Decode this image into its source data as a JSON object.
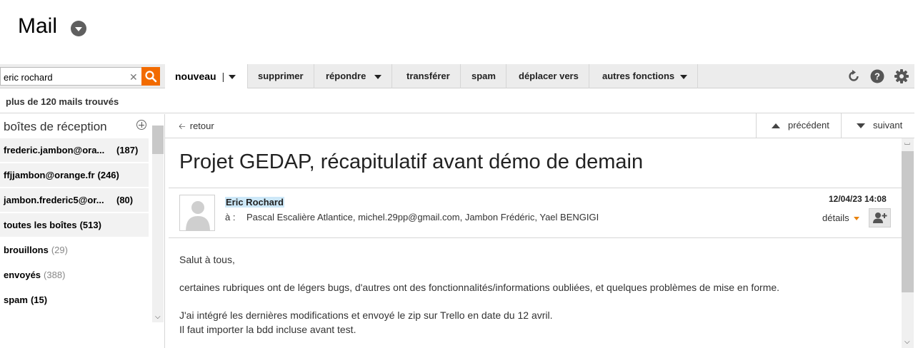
{
  "app": {
    "title": "Mail"
  },
  "search": {
    "value": "eric rochard",
    "clear_icon": "close-icon",
    "button_icon": "search-icon",
    "accent": "#f26b00"
  },
  "toolbar": {
    "nouveau": "nouveau",
    "nouveau_sep": "|",
    "supprimer": "supprimer",
    "repondre": "répondre",
    "transferer": "transférer",
    "spam": "spam",
    "deplacer": "déplacer vers",
    "autres": "autres fonctions",
    "icons": [
      "refresh-icon",
      "help-icon",
      "gear-icon"
    ]
  },
  "results": {
    "text": "plus de 120 mails trouvés"
  },
  "sidebar": {
    "heading": "boîtes de réception",
    "items": [
      {
        "label": "frederic.jambon@ora...",
        "count": "(187)"
      },
      {
        "label": "ffjjambon@orange.fr",
        "count": "(246)"
      },
      {
        "label": "jambon.frederic5@or...",
        "count": "(80)"
      },
      {
        "label": "toutes les boîtes",
        "count": "(513)"
      },
      {
        "label": "brouillons",
        "count": "(29)"
      },
      {
        "label": "envoyés",
        "count": "(388)"
      },
      {
        "label": "spam",
        "count": "(15)"
      }
    ]
  },
  "message": {
    "back": "retour",
    "previous": "précédent",
    "next": "suivant",
    "subject": "Projet GEDAP, récapitulatif avant démo de demain",
    "sender": "Eric Rochard",
    "to_label": "à :",
    "recipients": "Pascal Escalière Atlantice, michel.29pp@gmail.com, Jambon Frédéric, Yael BENGIGI",
    "date": "12/04/23 14:08",
    "details": "détails",
    "body": [
      "Salut à tous,",
      "certaines rubriques ont de légers bugs, d'autres ont des fonctionnalités/informations oubliées, et quelques problèmes de mise en forme.",
      "J'ai intégré les dernières modifications et envoyé le zip sur Trello en date du 12 avril.",
      "Il faut importer la bdd incluse avant test."
    ]
  }
}
